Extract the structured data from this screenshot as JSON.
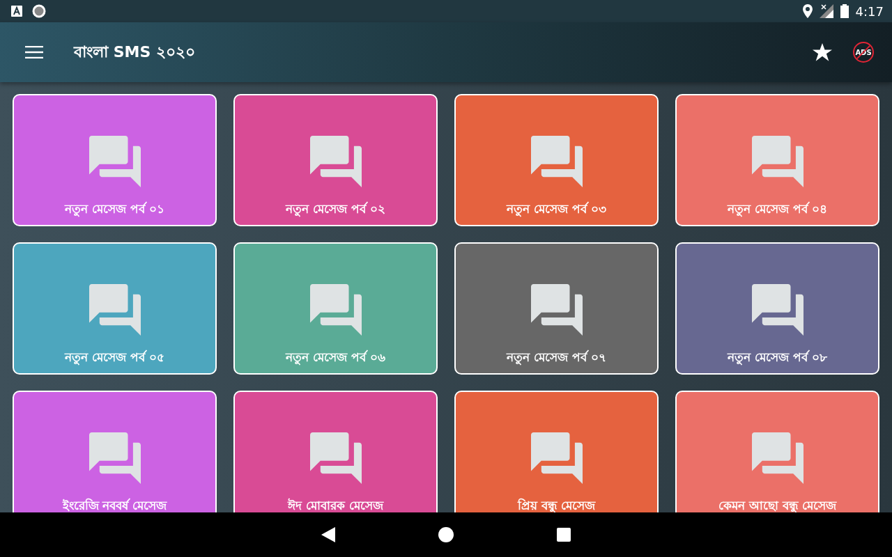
{
  "status_bar": {
    "time": "4:17"
  },
  "app_bar": {
    "title": "বাংলা SMS ২০২০",
    "ads_label": "ADS"
  },
  "categories": [
    {
      "label": "নতুন মেসেজ পর্ব ০১",
      "color": "#cc62e3"
    },
    {
      "label": "নতুন মেসেজ পর্ব ০২",
      "color": "#d94b95"
    },
    {
      "label": "নতুন মেসেজ পর্ব ০৩",
      "color": "#e5623f"
    },
    {
      "label": "নতুন মেসেজ পর্ব ০৪",
      "color": "#eb7068"
    },
    {
      "label": "নতুন মেসেজ পর্ব ০৫",
      "color": "#4da6be"
    },
    {
      "label": "নতুন মেসেজ পর্ব ০৬",
      "color": "#5aab96"
    },
    {
      "label": "নতুন মেসেজ পর্ব ০৭",
      "color": "#676767"
    },
    {
      "label": "নতুন মেসেজ পর্ব ০৮",
      "color": "#676891"
    },
    {
      "label": "ইংরেজি নববর্ষ মেসেজ",
      "color": "#cc62e3"
    },
    {
      "label": "ঈদ মোবারক মেসেজ",
      "color": "#d94b95"
    },
    {
      "label": "প্রিয় বন্ধু মেসেজ",
      "color": "#e5623f"
    },
    {
      "label": "কেমন আছো বন্ধু মেসেজ",
      "color": "#eb7068"
    }
  ]
}
